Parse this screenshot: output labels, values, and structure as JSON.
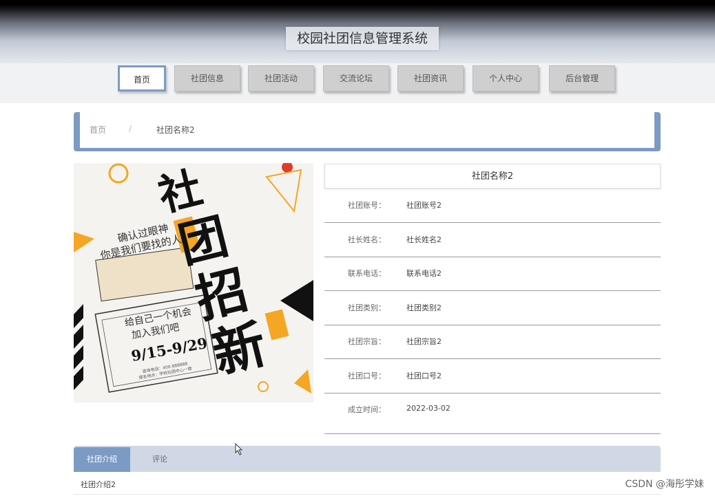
{
  "header": {
    "title": "校园社团信息管理系统"
  },
  "nav": {
    "items": [
      "首页",
      "社团信息",
      "社团活动",
      "交流论坛",
      "社团资讯",
      "个人中心",
      "后台管理"
    ],
    "active": "首页"
  },
  "breadcrumb": {
    "home": "首页",
    "separator": "/",
    "current": "社团名称2"
  },
  "poster": {
    "headline_chars": [
      "社",
      "团",
      "招",
      "新"
    ],
    "tagline_1": "确认过眼神",
    "tagline_2": "你是我们要找的人",
    "offer_1": "给自己一个机会",
    "offer_2": "加入我们吧",
    "dates": "9/15-9/29",
    "contact_1": "咨询电话：400-888888",
    "contact_2": "报名地点：学校社团中心一楼"
  },
  "detail": {
    "title": "社团名称2",
    "rows": [
      {
        "label": "社团账号：",
        "value": "社团账号2"
      },
      {
        "label": "社长姓名：",
        "value": "社长姓名2"
      },
      {
        "label": "联系电话：",
        "value": "联系电话2"
      },
      {
        "label": "社团类别：",
        "value": "社团类别2"
      },
      {
        "label": "社团宗旨：",
        "value": "社团宗旨2"
      },
      {
        "label": "社团口号：",
        "value": "社团口号2"
      },
      {
        "label": "成立时间：",
        "value": "2022-03-02"
      }
    ]
  },
  "tabs": {
    "items": [
      "社团介绍",
      "评论"
    ],
    "active": "社团介绍",
    "content": "社团介绍2"
  },
  "watermark": "CSDN @海彤学妹",
  "colors": {
    "accent": "#7c9bc4",
    "poster_yellow": "#f5a623",
    "poster_black": "#111111"
  }
}
